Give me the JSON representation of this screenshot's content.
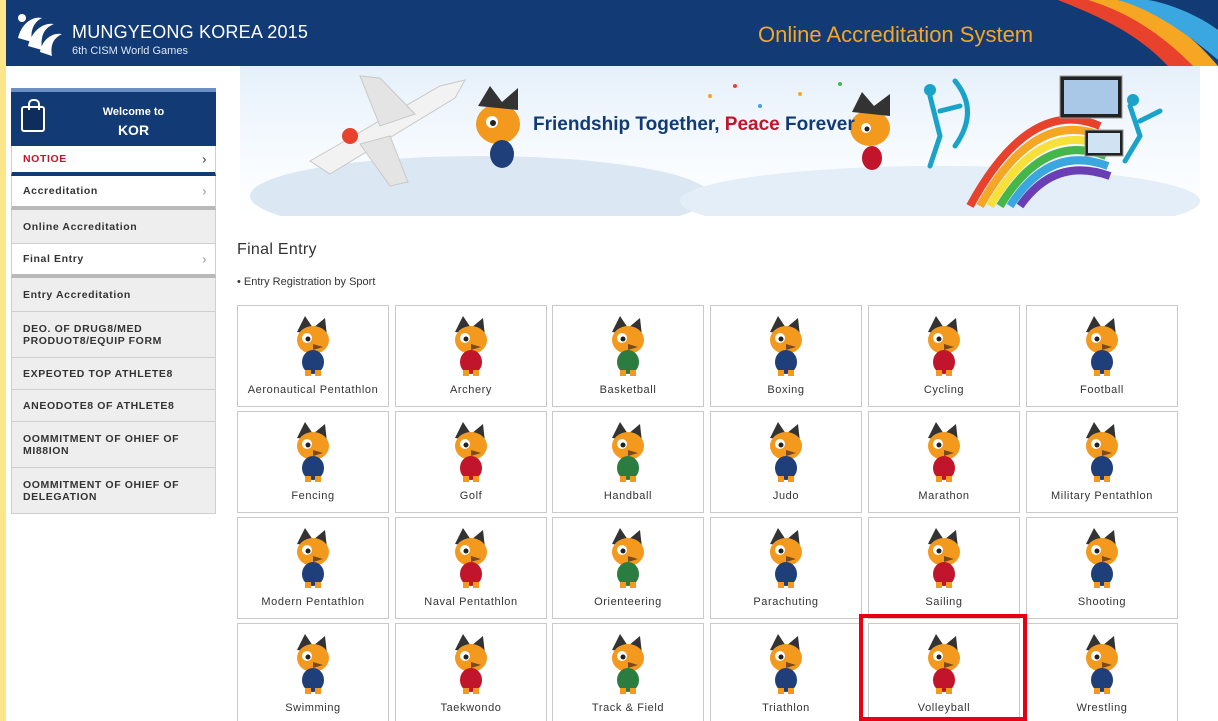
{
  "header": {
    "logo_title": "MUNGYEONG KOREA 2015",
    "logo_sub": "6th CISM World Games",
    "system_title": "Online Accreditation System"
  },
  "sidebar": {
    "welcome_line": "Welcome to",
    "welcome_user": "KOR",
    "items": [
      {
        "label": "NOTIOE",
        "kind": "notice"
      },
      {
        "label": "Accreditation",
        "kind": "group"
      },
      {
        "label": "Online Accreditation",
        "kind": "sub"
      },
      {
        "label": "Final Entry",
        "kind": "group"
      },
      {
        "label": "Entry Accreditation",
        "kind": "sub"
      },
      {
        "label": "DEO. OF DRUG8/MED PRODUOT8/EQUIP FORM",
        "kind": "sub"
      },
      {
        "label": "EXPEOTED TOP ATHLETE8",
        "kind": "sub"
      },
      {
        "label": "ANEODOTE8 OF ATHLETE8",
        "kind": "sub"
      },
      {
        "label": "OOMMITMENT OF OHIEF OF MI88ION",
        "kind": "sub"
      },
      {
        "label": "OOMMITMENT OF OHIEF OF DELEGATION",
        "kind": "sub"
      }
    ]
  },
  "banner": {
    "text_1": "Friendship",
    "text_2": "Together,",
    "text_3": "Peace",
    "text_4": "Forever"
  },
  "main": {
    "title": "Final Entry",
    "subtitle": "Entry Registration by Sport",
    "sports": [
      "Aeronautical Pentathlon",
      "Archery",
      "Basketball",
      "Boxing",
      "Cycling",
      "Football",
      "Fencing",
      "Golf",
      "Handball",
      "Judo",
      "Marathon",
      "Military Pentathlon",
      "Modern Pentathlon",
      "Naval Pentathlon",
      "Orienteering",
      "Parachuting",
      "Sailing",
      "Shooting",
      "Swimming",
      "Taekwondo",
      "Track & Field",
      "Triathlon",
      "Volleyball",
      "Wrestling"
    ],
    "highlighted_sport": "Volleyball"
  },
  "colors": {
    "brand_navy": "#123a74",
    "accent_orange": "#f5a623",
    "notice_red": "#c0152b",
    "highlight_red": "#e60012"
  }
}
